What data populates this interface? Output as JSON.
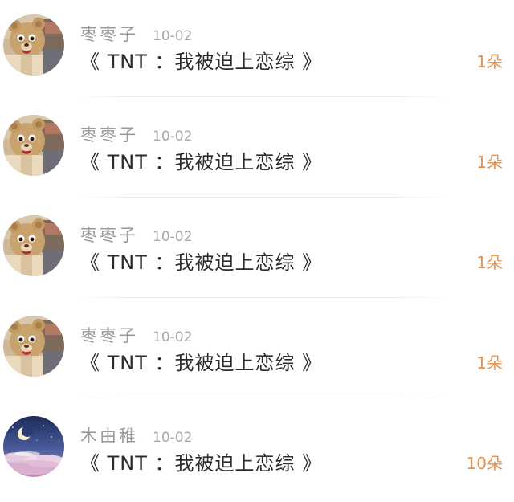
{
  "items": [
    {
      "avatar": "bear-mascot-avatar",
      "name": "枣枣子",
      "date": "10-02",
      "title": "《 TNT ：我被迫上恋综 》",
      "count": "1朵"
    },
    {
      "avatar": "bear-mascot-avatar",
      "name": "枣枣子",
      "date": "10-02",
      "title": "《 TNT ：我被迫上恋综 》",
      "count": "1朵"
    },
    {
      "avatar": "bear-mascot-avatar",
      "name": "枣枣子",
      "date": "10-02",
      "title": "《 TNT ：我被迫上恋综 》",
      "count": "1朵"
    },
    {
      "avatar": "bear-mascot-avatar",
      "name": "枣枣子",
      "date": "10-02",
      "title": "《 TNT ：我被迫上恋综 》",
      "count": "1朵"
    },
    {
      "avatar": "moon-night-sky-avatar",
      "name": "木由稚",
      "date": "10-02",
      "title": "《 TNT ：我被迫上恋综 》",
      "count": "10朵"
    }
  ],
  "colors": {
    "name": "#9a9a9a",
    "date": "#a8a8a8",
    "title": "#2c2c2c",
    "count": "#e8914a",
    "divider": "#ececec"
  }
}
